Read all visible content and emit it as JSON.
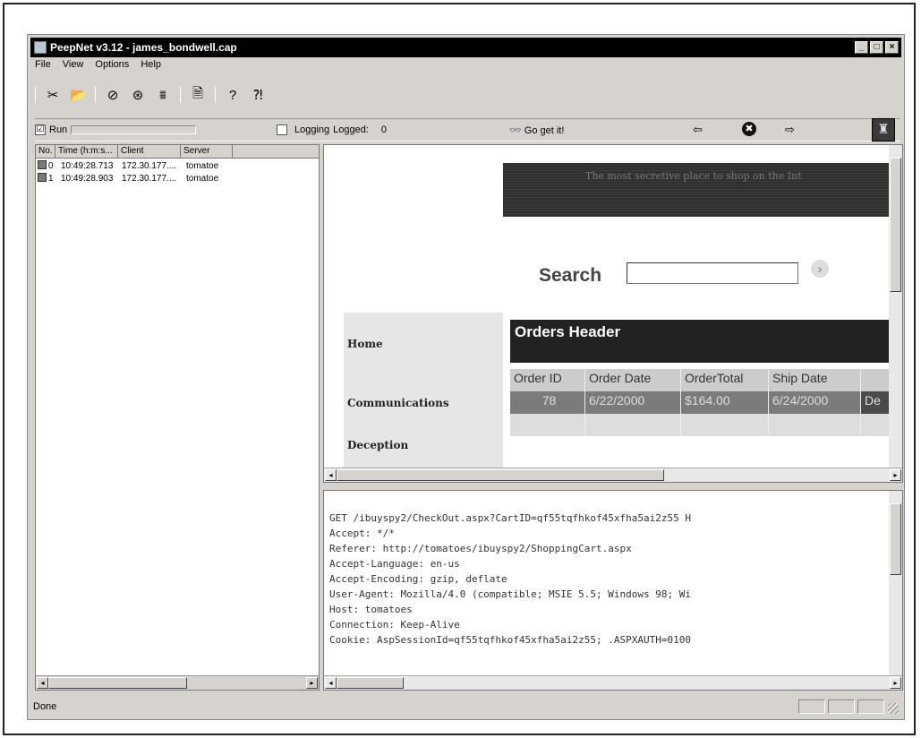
{
  "window": {
    "title": "PeepNet v3.12 - james_bondwell.cap",
    "controls": {
      "minimize": "_",
      "maximize": "□",
      "close": "×"
    }
  },
  "menu": [
    "File",
    "View",
    "Options",
    "Help"
  ],
  "toolbar": {
    "icons": [
      "cut-icon",
      "open-icon",
      "capture-icon",
      "filter-icon",
      "stats-icon",
      "document-icon",
      "help-icon",
      "context-help-icon"
    ],
    "glyphs": [
      "✂",
      "📂",
      "⊘",
      "⊛",
      "⩩",
      "🗎",
      "?",
      "⁈"
    ]
  },
  "runbar": {
    "run_checked": "☑",
    "run_label": "Run",
    "logging_label": "Logging",
    "logged_label": "Logged:",
    "logged_count": "0",
    "goget_label": "Go get it!",
    "back_glyph": "⇦",
    "stop_glyph": "✖",
    "forward_glyph": "⇨",
    "corner_glyph": "♜"
  },
  "packets": {
    "columns": [
      "No.",
      "Time (h:m:s...",
      "Client",
      "Server"
    ],
    "rows": [
      {
        "no": "0",
        "time": "10:49:28.713",
        "client": "172.30.177....",
        "server": "tomatoe"
      },
      {
        "no": "1",
        "time": "10:49:28.903",
        "client": "172.30.177....",
        "server": "tomatoe"
      }
    ]
  },
  "browser": {
    "banner_text": "The most secretive place to shop on the Int",
    "search_label": "Search",
    "search_value": "",
    "search_go_glyph": "›",
    "nav": [
      "Home",
      "Communications",
      "Deception"
    ],
    "orders_header": "Orders Header",
    "order_columns": [
      "Order ID",
      "Order Date",
      "OrderTotal",
      "Ship Date",
      ""
    ],
    "order_row": [
      "78",
      "6/22/2000",
      "$164.00",
      "6/24/2000",
      "De"
    ]
  },
  "request": {
    "lines": [
      "GET /ibuyspy2/CheckOut.aspx?CartID=qf55tqfhkof45xfha5ai2z55 H",
      "Accept: */*",
      "Referer: http://tomatoes/ibuyspy2/ShoppingCart.aspx",
      "Accept-Language: en-us",
      "Accept-Encoding: gzip, deflate",
      "User-Agent: Mozilla/4.0 (compatible; MSIE 5.5; Windows 98; Wi",
      "Host: tomatoes",
      "Connection: Keep-Alive",
      "Cookie: AspSessionId=qf55tqfhkof45xfha5ai2z55; .ASPXAUTH=0100"
    ]
  },
  "status": {
    "text": "Done"
  },
  "scroll_glyphs": {
    "left": "◂",
    "right": "▸"
  }
}
